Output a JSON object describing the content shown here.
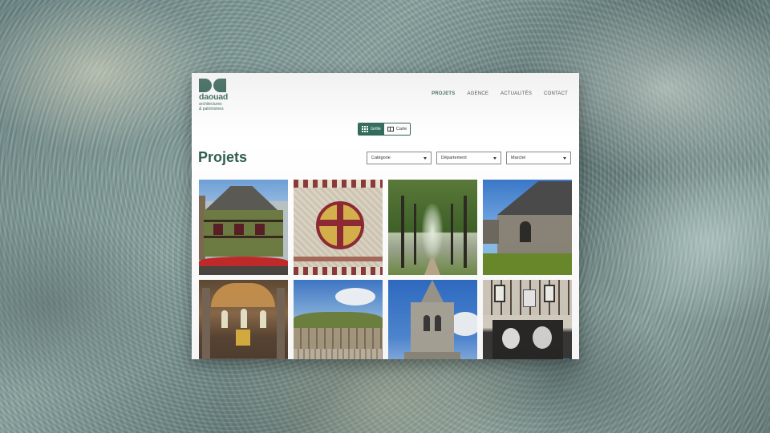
{
  "logo": {
    "name": "daouad",
    "tagline_line1": "architectures",
    "tagline_line2": "& patrimoines"
  },
  "nav": {
    "items": [
      "PROJETS",
      "AGENCE",
      "ACTUALITÉS",
      "CONTACT"
    ]
  },
  "view_toggle": {
    "grid_label": "Grille",
    "map_label": "Carte",
    "selected": "Grille"
  },
  "page": {
    "title": "Projets"
  },
  "filters": {
    "category": "Catégorie",
    "department": "Département",
    "market": "Marché"
  },
  "projects": [
    {
      "subject": "timber-framed-house"
    },
    {
      "subject": "mosaic-cross"
    },
    {
      "subject": "tree-lined-avenue"
    },
    {
      "subject": "stone-chapel"
    },
    {
      "subject": "church-interior"
    },
    {
      "subject": "stone-wall"
    },
    {
      "subject": "church-tower"
    },
    {
      "subject": "half-timbered-storefront"
    }
  ],
  "colors": {
    "brand": "#2f5f52",
    "toggle_active": "#2f6b5a"
  }
}
